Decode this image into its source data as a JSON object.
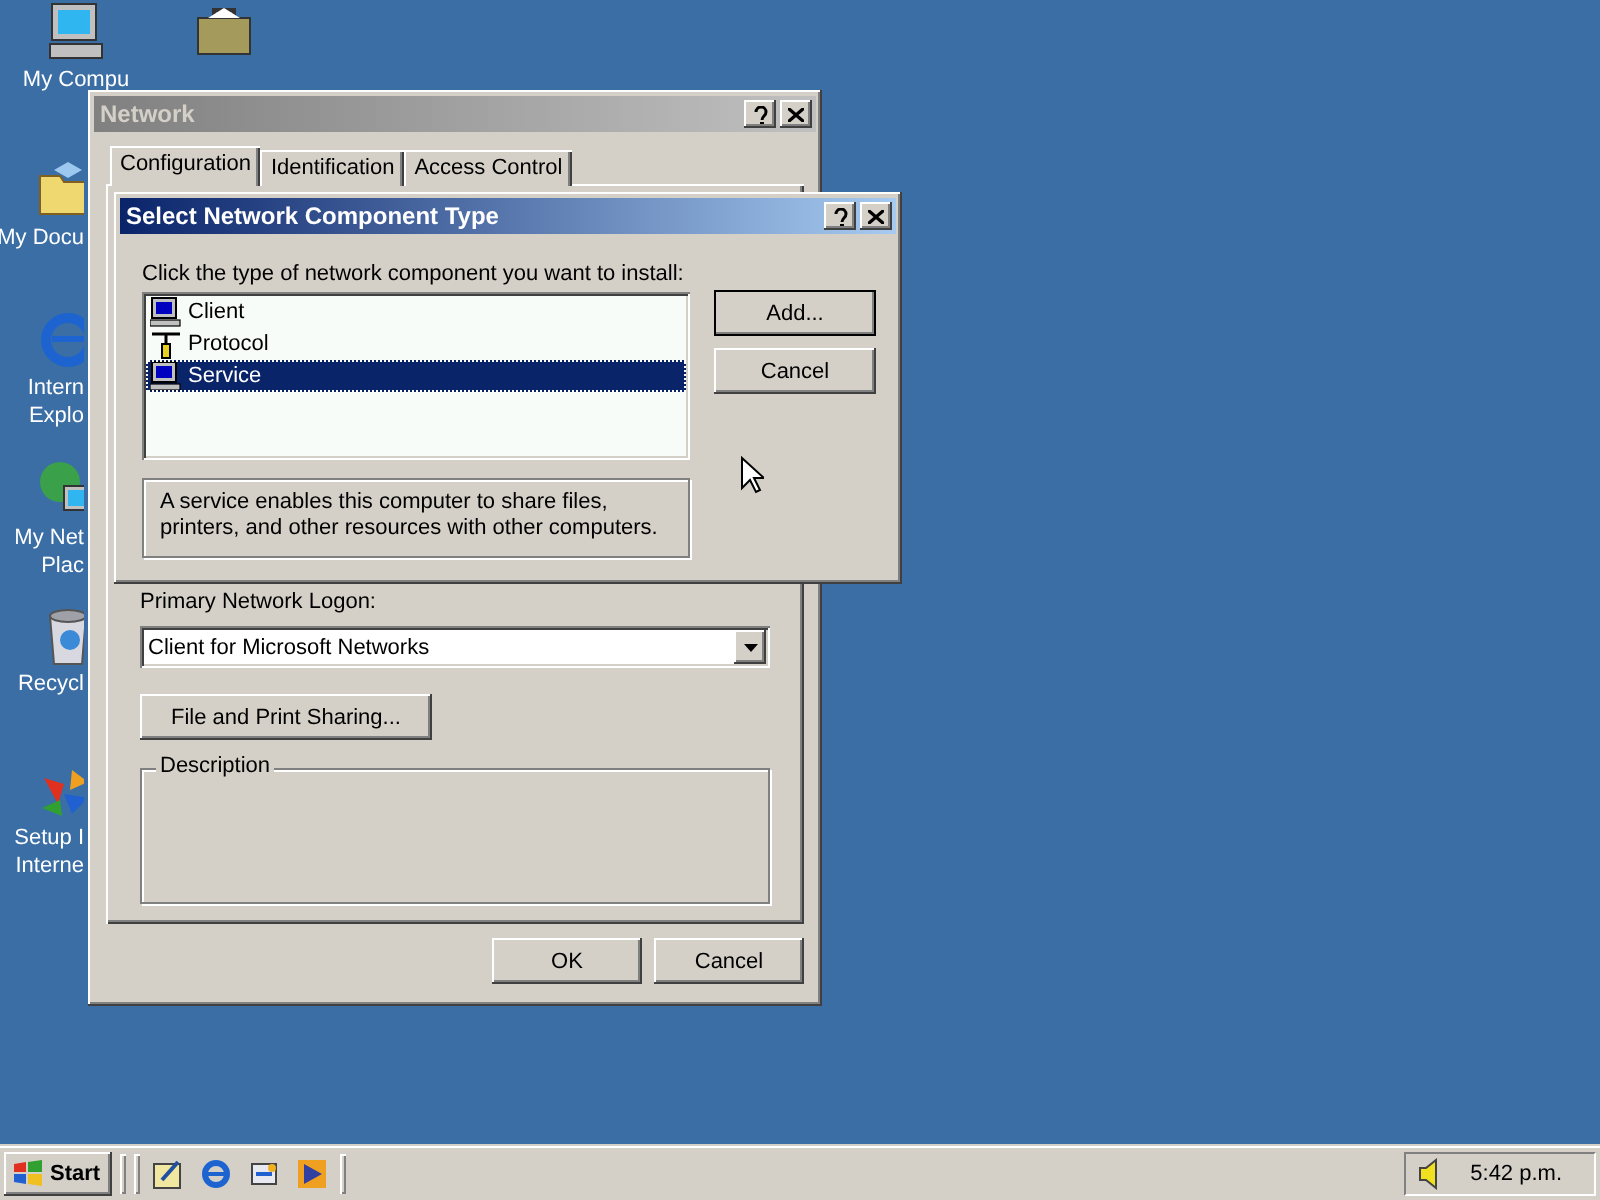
{
  "desktop": {
    "icons": [
      {
        "kind": "computer",
        "label_lines": [
          "My Compu"
        ]
      },
      {
        "kind": "briefcase"
      },
      {
        "kind": "documents",
        "label_lines": [
          "My Docu"
        ]
      },
      {
        "kind": "browser",
        "label_lines": [
          "Intern",
          "Explo"
        ]
      },
      {
        "kind": "network",
        "label_lines": [
          "My Net",
          "Plac"
        ]
      },
      {
        "kind": "recycle",
        "label_lines": [
          "Recycl"
        ]
      },
      {
        "kind": "setup",
        "label_lines": [
          "Setup I",
          "Interne"
        ]
      }
    ]
  },
  "network_window": {
    "title": "Network",
    "tabs": [
      {
        "label": "Configuration",
        "selected": true
      },
      {
        "label": "Identification",
        "selected": false
      },
      {
        "label": "Access Control",
        "selected": false
      }
    ],
    "logon_label": "Primary Network Logon:",
    "logon_value": "Client for Microsoft Networks",
    "sharing_button": "File and Print Sharing...",
    "description_title": "Description",
    "buttons": [
      "OK",
      "Cancel"
    ]
  },
  "dialog": {
    "title": "Select Network Component Type",
    "prompt": "Click the type of network component you want to install:",
    "items": [
      {
        "kind": "client",
        "label": "Client",
        "selected": false
      },
      {
        "kind": "protocol",
        "label": "Protocol",
        "selected": false
      },
      {
        "kind": "service",
        "label": "Service",
        "selected": true
      }
    ],
    "description": "A service enables this computer to share files, printers, and other resources with other computers.",
    "buttons": [
      "Add...",
      "Cancel"
    ]
  },
  "taskbar": {
    "start": "Start",
    "quick_launch": [
      {
        "kind": "desktop"
      },
      {
        "kind": "browser"
      },
      {
        "kind": "channels"
      },
      {
        "kind": "media"
      }
    ],
    "time": "5:42 p.m."
  }
}
